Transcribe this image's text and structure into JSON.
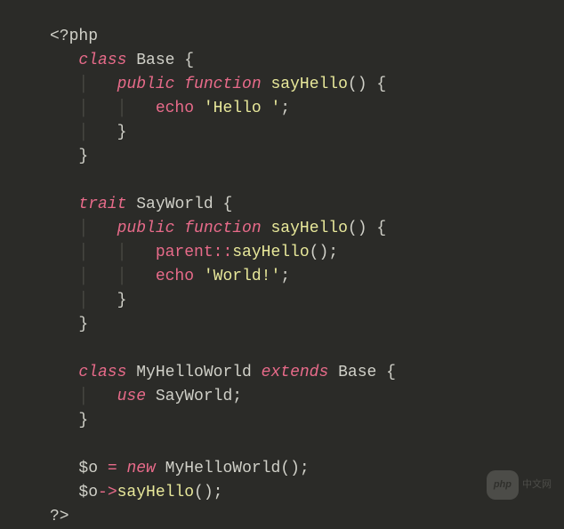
{
  "code": {
    "l1_open": "<?php",
    "l2_class": "class",
    "l2_name": "Base",
    "l2_brace": "{",
    "l3_pub": "public",
    "l3_func": "function",
    "l3_name": "sayHello",
    "l3_parens": "()",
    "l3_brace": "{",
    "l4_echo": "echo",
    "l4_str": "'Hello '",
    "l4_semi": ";",
    "l5_brace": "}",
    "l6_brace": "}",
    "l8_trait": "trait",
    "l8_name": "SayWorld",
    "l8_brace": "{",
    "l9_pub": "public",
    "l9_func": "function",
    "l9_name": "sayHello",
    "l9_parens": "()",
    "l9_brace": "{",
    "l10_parent": "parent",
    "l10_scope": "::",
    "l10_call": "sayHello",
    "l10_parens": "()",
    "l10_semi": ";",
    "l11_echo": "echo",
    "l11_str": "'World!'",
    "l11_semi": ";",
    "l12_brace": "}",
    "l13_brace": "}",
    "l15_class": "class",
    "l15_name": "MyHelloWorld",
    "l15_ext": "extends",
    "l15_base": "Base",
    "l15_brace": "{",
    "l16_use": "use",
    "l16_name": "SayWorld",
    "l16_semi": ";",
    "l17_brace": "}",
    "l19_var": "$o",
    "l19_eq": "=",
    "l19_new": "new",
    "l19_name": "MyHelloWorld",
    "l19_parens": "()",
    "l19_semi": ";",
    "l20_var": "$o",
    "l20_arrow": "->",
    "l20_call": "sayHello",
    "l20_parens": "()",
    "l20_semi": ";",
    "l21_close": "?>"
  },
  "watermark": {
    "badge": "php",
    "text": "中文网"
  }
}
